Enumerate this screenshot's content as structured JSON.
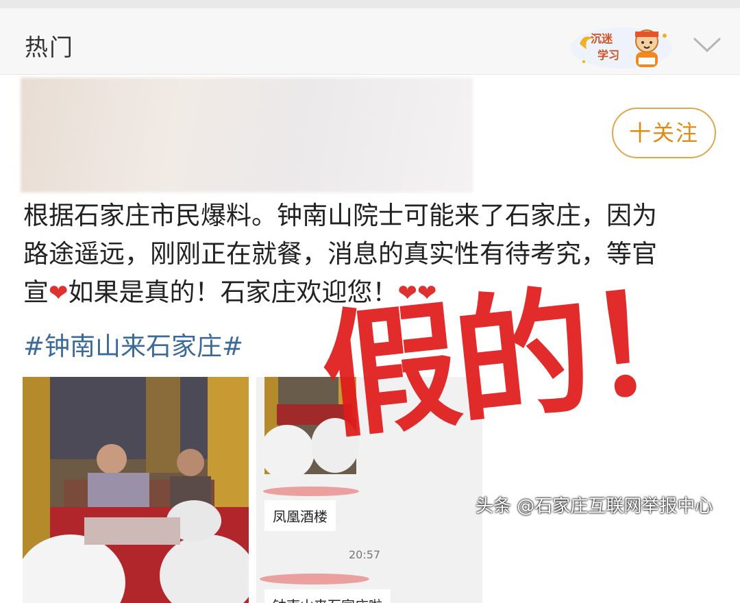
{
  "header": {
    "title": "热门",
    "logo_text": "沉迷学习",
    "dropdown_icon": "chevron-down-icon"
  },
  "post": {
    "follow_label": "十关注",
    "body_lines": [
      "根据石家庄市民爆料。钟南山院士可能来了石家庄，因为",
      "路途遥远，刚刚正在就餐，消息的真实性有待考究，等官",
      "宣",
      "如果是真的！石家庄欢迎您！"
    ],
    "hashtag": "#钟南山来石家庄#",
    "stamp": "假的！",
    "image2": {
      "msg1": "凤凰酒楼",
      "time": "20:57",
      "msg2": "钟南山来石家庄啦"
    }
  },
  "watermark": "头条 @石家庄互联网举报中心",
  "colors": {
    "accent": "#e08a16",
    "hashtag": "#3c6a98",
    "stamp": "#e01b1b"
  }
}
